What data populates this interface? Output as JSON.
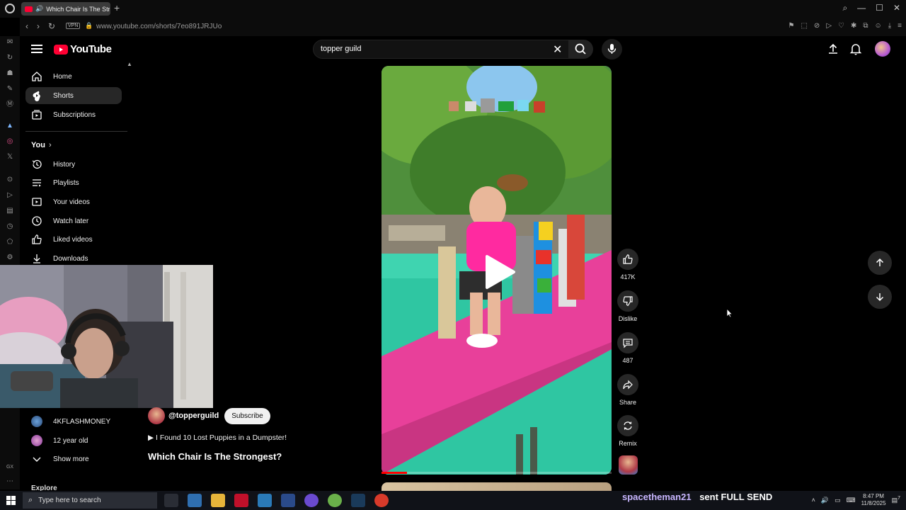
{
  "browser": {
    "tab_title": "Which Chair Is The Strongest?",
    "url": "www.youtube.com/shorts/7eo891JRJUo",
    "vpn_label": "VPN"
  },
  "youtube": {
    "logo_text": "YouTube",
    "search_value": "topper guild",
    "nav": {
      "home": "Home",
      "shorts": "Shorts",
      "subscriptions": "Subscriptions",
      "you": "You",
      "history": "History",
      "playlists": "Playlists",
      "your_videos": "Your videos",
      "watch_later": "Watch later",
      "liked_videos": "Liked videos",
      "downloads": "Downloads",
      "sub_1": "4KFLASHMONEY",
      "sub_2": "12 year old",
      "show_more": "Show more",
      "explore": "Explore"
    },
    "short": {
      "channel_handle": "@topperguild",
      "subscribe_label": "Subscribe",
      "linked_video": "I Found 10 Lost Puppies in a Dumpster!",
      "title": "Which Chair Is The Strongest?",
      "progress": 0.11
    },
    "actions": {
      "likes": "417K",
      "dislike_label": "Dislike",
      "comments": "487",
      "share_label": "Share",
      "remix_label": "Remix"
    }
  },
  "taskbar": {
    "search_placeholder": "Type here to search",
    "time": "8:47 PM",
    "date": "11/8/2025",
    "notification_count": "7"
  },
  "stream_alert": {
    "user": "spacetheman21",
    "message": "sent FULL SEND"
  },
  "colors": {
    "yt_red": "#ff0033",
    "pink_beam": "#e8409a",
    "pool": "#3fd4b0",
    "alert_user": "#c8b6ff"
  }
}
